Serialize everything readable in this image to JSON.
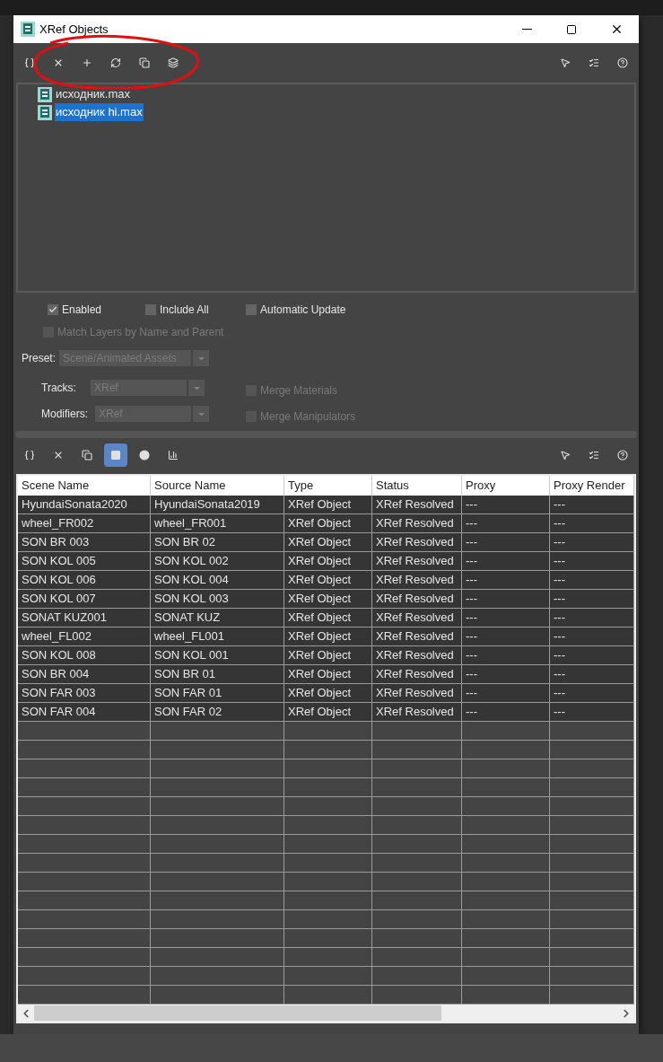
{
  "window": {
    "title": "XRef Objects"
  },
  "top_toolbar": {
    "left": [
      {
        "kind": "braces",
        "selected": false
      },
      {
        "kind": "remove",
        "selected": false
      },
      {
        "kind": "add",
        "selected": false
      },
      {
        "kind": "refresh",
        "selected": false
      },
      {
        "kind": "copy",
        "selected": false
      },
      {
        "kind": "merge",
        "selected": false
      }
    ],
    "right": [
      {
        "kind": "pointer",
        "selected": false
      },
      {
        "kind": "list-pointer",
        "selected": false
      },
      {
        "kind": "help",
        "selected": false
      }
    ]
  },
  "files": [
    {
      "name": "исходник.max",
      "selected": false
    },
    {
      "name": "исходник hi.max",
      "selected": true
    }
  ],
  "options": {
    "enabled": {
      "label": "Enabled",
      "checked": true,
      "disabled": false
    },
    "include_all": {
      "label": "Include All",
      "checked": false,
      "disabled": false
    },
    "automatic_update": {
      "label": "Automatic Update",
      "checked": false,
      "disabled": false
    },
    "match_layers": {
      "label": "Match Layers by Name and Parent",
      "checked": false,
      "disabled": true
    },
    "preset": {
      "label": "Preset:",
      "value": "Scene/Animated Assets"
    },
    "tracks": {
      "label": "Tracks:",
      "value": "XRef"
    },
    "modifiers": {
      "label": "Modifiers:",
      "value": "XRef"
    },
    "merge_materials": {
      "label": "Merge Materials",
      "checked": false,
      "disabled": true
    },
    "merge_manipulators": {
      "label": "Merge Manipulators",
      "checked": false,
      "disabled": true
    }
  },
  "bottom_toolbar": {
    "left": [
      {
        "kind": "braces",
        "selected": false
      },
      {
        "kind": "remove",
        "selected": false
      },
      {
        "kind": "copy",
        "selected": false
      },
      {
        "kind": "square",
        "selected": true
      },
      {
        "kind": "dot",
        "selected": false
      },
      {
        "kind": "chart",
        "selected": false
      }
    ],
    "right": [
      {
        "kind": "pointer",
        "selected": false
      },
      {
        "kind": "list-pointer",
        "selected": false
      },
      {
        "kind": "help",
        "selected": false
      }
    ]
  },
  "table": {
    "columns": [
      "Scene Name",
      "Source Name",
      "Type",
      "Status",
      "Proxy",
      "Proxy Render"
    ],
    "rows": [
      [
        "HyundaiSonata2020",
        "HyundaiSonata2019",
        "XRef Object",
        "XRef Resolved",
        "---",
        "---"
      ],
      [
        "wheel_FR002",
        "wheel_FR001",
        "XRef Object",
        "XRef Resolved",
        "---",
        "---"
      ],
      [
        "SON BR 003",
        "SON BR 02",
        "XRef Object",
        "XRef Resolved",
        "---",
        "---"
      ],
      [
        "SON KOL 005",
        "SON KOL 002",
        "XRef Object",
        "XRef Resolved",
        "---",
        "---"
      ],
      [
        "SON KOL 006",
        "SON KOL 004",
        "XRef Object",
        "XRef Resolved",
        "---",
        "---"
      ],
      [
        "SON KOL 007",
        "SON KOL 003",
        "XRef Object",
        "XRef Resolved",
        "---",
        "---"
      ],
      [
        "SONAT KUZ001",
        "SONAT KUZ",
        "XRef Object",
        "XRef Resolved",
        "---",
        "---"
      ],
      [
        "wheel_FL002",
        "wheel_FL001",
        "XRef Object",
        "XRef Resolved",
        "---",
        "---"
      ],
      [
        "SON KOL 008",
        "SON KOL 001",
        "XRef Object",
        "XRef Resolved",
        "---",
        "---"
      ],
      [
        "SON BR 004",
        "SON BR 01",
        "XRef Object",
        "XRef Resolved",
        "---",
        "---"
      ],
      [
        "SON FAR 003",
        "SON FAR 01",
        "XRef Object",
        "XRef Resolved",
        "---",
        "---"
      ],
      [
        "SON FAR 004",
        "SON FAR 02",
        "XRef Object",
        "XRef Resolved",
        "---",
        "---"
      ]
    ]
  }
}
